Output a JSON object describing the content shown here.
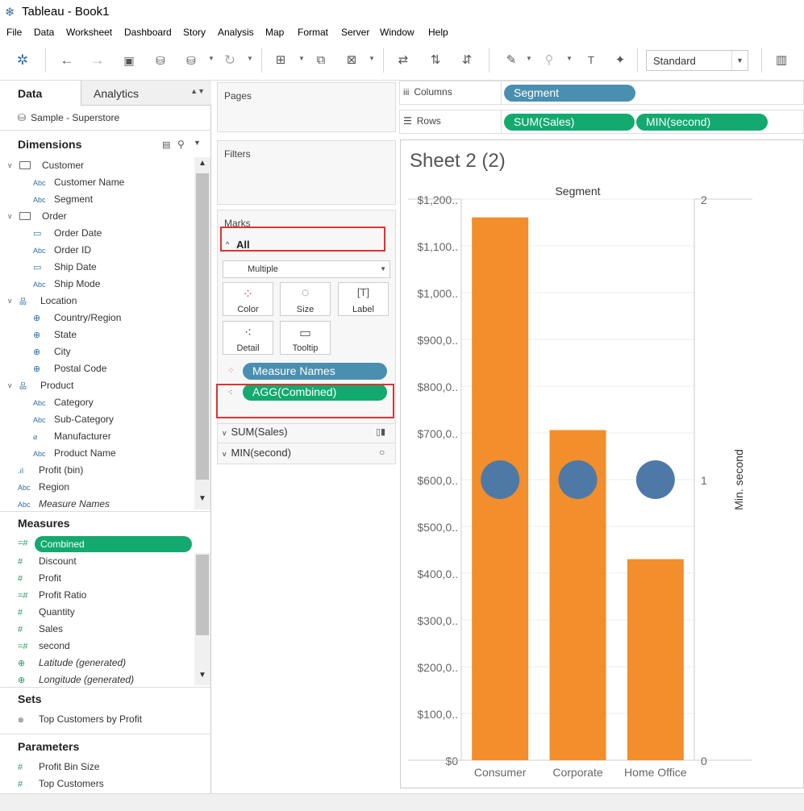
{
  "window": {
    "title": "Tableau - Book1"
  },
  "menu": [
    "File",
    "Data",
    "Worksheet",
    "Dashboard",
    "Story",
    "Analysis",
    "Map",
    "Format",
    "Server",
    "Window",
    "Help"
  ],
  "toolbar": {
    "fit_select": "Standard"
  },
  "data_pane": {
    "tab_data": "Data",
    "tab_analytics": "Analytics",
    "datasource": "Sample - Superstore",
    "dimensions_header": "Dimensions",
    "dimensions": [
      {
        "label": "Customer",
        "type": "folder",
        "level": 0
      },
      {
        "label": "Customer Name",
        "type": "Abc",
        "level": 1
      },
      {
        "label": "Segment",
        "type": "Abc",
        "level": 1
      },
      {
        "label": "Order",
        "type": "folder",
        "level": 0
      },
      {
        "label": "Order Date",
        "type": "date",
        "level": 1
      },
      {
        "label": "Order ID",
        "type": "Abc",
        "level": 1
      },
      {
        "label": "Ship Date",
        "type": "date",
        "level": 1
      },
      {
        "label": "Ship Mode",
        "type": "Abc",
        "level": 1
      },
      {
        "label": "Location",
        "type": "hier",
        "level": 0
      },
      {
        "label": "Country/Region",
        "type": "geo",
        "level": 1
      },
      {
        "label": "State",
        "type": "geo",
        "level": 1
      },
      {
        "label": "City",
        "type": "geo",
        "level": 1
      },
      {
        "label": "Postal Code",
        "type": "geo",
        "level": 1
      },
      {
        "label": "Product",
        "type": "hier",
        "level": 0
      },
      {
        "label": "Category",
        "type": "Abc",
        "level": 1
      },
      {
        "label": "Sub-Category",
        "type": "Abc",
        "level": 1
      },
      {
        "label": "Manufacturer",
        "type": "clip",
        "level": 1
      },
      {
        "label": "Product Name",
        "type": "Abc",
        "level": 1
      },
      {
        "label": "Profit (bin)",
        "type": "bin",
        "level": 0
      },
      {
        "label": "Region",
        "type": "Abc",
        "level": 0
      },
      {
        "label": "Measure Names",
        "type": "Abc",
        "level": 0,
        "italic": true
      }
    ],
    "measures_header": "Measures",
    "measures": [
      {
        "label": "Combined",
        "type": "=#",
        "selected": true
      },
      {
        "label": "Discount",
        "type": "#"
      },
      {
        "label": "Profit",
        "type": "#"
      },
      {
        "label": "Profit Ratio",
        "type": "=#"
      },
      {
        "label": "Quantity",
        "type": "#"
      },
      {
        "label": "Sales",
        "type": "#"
      },
      {
        "label": "second",
        "type": "=#"
      },
      {
        "label": "Latitude (generated)",
        "type": "geo",
        "italic": true
      },
      {
        "label": "Longitude (generated)",
        "type": "geo",
        "italic": true
      }
    ],
    "sets_header": "Sets",
    "sets": [
      {
        "label": "Top Customers by Profit"
      }
    ],
    "parameters_header": "Parameters",
    "parameters": [
      {
        "label": "Profit Bin Size"
      },
      {
        "label": "Top Customers"
      }
    ]
  },
  "shelves": {
    "pages": "Pages",
    "filters": "Filters",
    "marks": "Marks",
    "marks_all": "All",
    "mark_type": "Multiple",
    "buttons": {
      "color": "Color",
      "size": "Size",
      "label": "Label",
      "detail": "Detail",
      "tooltip": "Tooltip"
    },
    "pill_measure_names": "Measure Names",
    "pill_agg_combined": "AGG(Combined)",
    "sub_sum_sales": "SUM(Sales)",
    "sub_min_second": "MIN(second)",
    "columns_label": "Columns",
    "rows_label": "Rows",
    "columns_pill": "Segment",
    "rows_pill_1": "SUM(Sales)",
    "rows_pill_2": "MIN(second)"
  },
  "sheet": {
    "title": "Sheet 2 (2)"
  },
  "colors": {
    "bar": "#f28e2b",
    "circle": "#4e79a7",
    "pill_blue": "#4a8fb0",
    "pill_green": "#13a96f"
  },
  "chart_data": {
    "type": "bar",
    "title": "",
    "header": "Segment",
    "categories": [
      "Consumer",
      "Corporate",
      "Home Office"
    ],
    "series": [
      {
        "values": [
          1161000,
          706000,
          430000
        ],
        "mark": "bar"
      },
      {
        "values": [
          1,
          1,
          1
        ],
        "mark": "circle",
        "axis": "right"
      }
    ],
    "y_left": {
      "ylim": [
        0,
        1200000
      ],
      "ticks": [
        "$0",
        "$100,0..",
        "$200,0..",
        "$300,0..",
        "$400,0..",
        "$500,0..",
        "$600,0..",
        "$700,0..",
        "$800,0..",
        "$900,0..",
        "$1,000..",
        "$1,100..",
        "$1,200.."
      ]
    },
    "y_right": {
      "ylim": [
        0,
        2
      ],
      "ticks": [
        "0",
        "1",
        "2"
      ],
      "label": "Min. second"
    },
    "grid": true
  }
}
